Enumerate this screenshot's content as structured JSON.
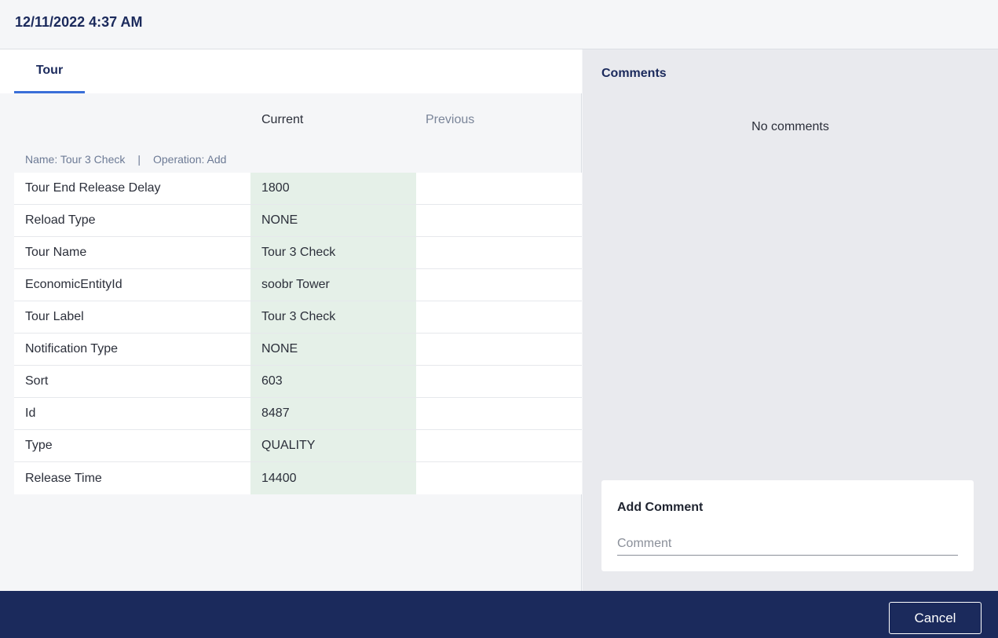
{
  "header": {
    "title": "12/11/2022 4:37 AM"
  },
  "tabs": [
    {
      "label": "Tour"
    }
  ],
  "table": {
    "columns": {
      "current": "Current",
      "previous": "Previous"
    },
    "meta": {
      "name": "Name: Tour 3 Check",
      "operation": "Operation: Add"
    },
    "rows": [
      {
        "label": "Tour End Release Delay",
        "current": "1800",
        "previous": ""
      },
      {
        "label": "Reload Type",
        "current": "NONE",
        "previous": ""
      },
      {
        "label": "Tour Name",
        "current": "Tour 3 Check",
        "previous": ""
      },
      {
        "label": "EconomicEntityId",
        "current": "soobr Tower",
        "previous": ""
      },
      {
        "label": "Tour Label",
        "current": "Tour 3 Check",
        "previous": ""
      },
      {
        "label": "Notification Type",
        "current": "NONE",
        "previous": ""
      },
      {
        "label": "Sort",
        "current": "603",
        "previous": ""
      },
      {
        "label": "Id",
        "current": "8487",
        "previous": ""
      },
      {
        "label": "Type",
        "current": "QUALITY",
        "previous": ""
      },
      {
        "label": "Release Time",
        "current": "14400",
        "previous": ""
      }
    ]
  },
  "comments": {
    "title": "Comments",
    "empty": "No comments",
    "add_title": "Add Comment",
    "input_value": "",
    "input_placeholder": "Comment"
  },
  "footer": {
    "cancel_label": "Cancel"
  },
  "colors": {
    "navy": "#1b2a5c",
    "accent": "#3a6fd8",
    "current_bg": "#e5f0e8"
  }
}
